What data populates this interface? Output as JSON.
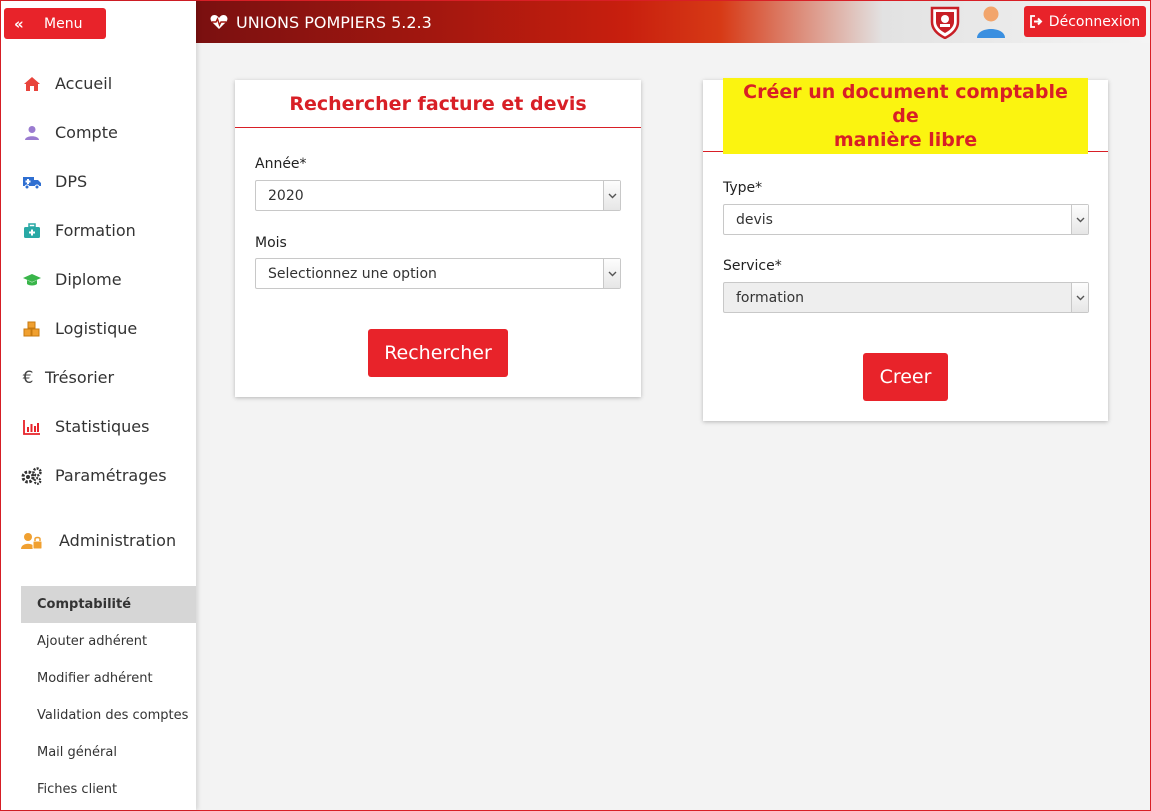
{
  "colors": {
    "accent": "#e8232a",
    "title_red": "#d81f26",
    "highlight_yellow": "#fbf410",
    "active_bg": "#d6d6d6"
  },
  "sidebar": {
    "menu_label": "Menu",
    "items": [
      {
        "label": "Accueil",
        "icon": "home-icon",
        "color": "#e8443c"
      },
      {
        "label": "Compte",
        "icon": "user-icon",
        "color": "#9a7bd0"
      },
      {
        "label": "DPS",
        "icon": "ambulance-icon",
        "color": "#2f6fd1"
      },
      {
        "label": "Formation",
        "icon": "medkit-icon",
        "color": "#29a9a5"
      },
      {
        "label": "Diplome",
        "icon": "graduation-cap-icon",
        "color": "#39b54a"
      },
      {
        "label": "Logistique",
        "icon": "cubes-icon",
        "color": "#f0a030"
      },
      {
        "label": "Trésorier",
        "icon": "euro-icon",
        "color": "#444444"
      },
      {
        "label": "Statistiques",
        "icon": "bar-chart-icon",
        "color": "#e8232a"
      },
      {
        "label": "Paramétrages",
        "icon": "gears-icon",
        "color": "#333333"
      },
      {
        "label": "Administration",
        "icon": "users-admin-icon",
        "color": "#f0a030"
      }
    ],
    "subitems": [
      "Comptabilité",
      "Ajouter adhérent",
      "Modifier adhérent",
      "Validation des comptes",
      "Mail général",
      "Fiches client"
    ]
  },
  "header": {
    "title": "UNIONS POMPIERS 5.2.3",
    "logout_label": "Déconnexion"
  },
  "search_card": {
    "title": "Rechercher facture et devis",
    "year_label": "Année*",
    "year_value": "2020",
    "month_label": "Mois",
    "month_value": "Selectionnez une option",
    "button": "Rechercher"
  },
  "create_card": {
    "title_line1": "Créer un document comptable de",
    "title_line2": "manière libre",
    "type_label": "Type*",
    "type_value": "devis",
    "service_label": "Service*",
    "service_value": "formation",
    "button": "Creer"
  }
}
